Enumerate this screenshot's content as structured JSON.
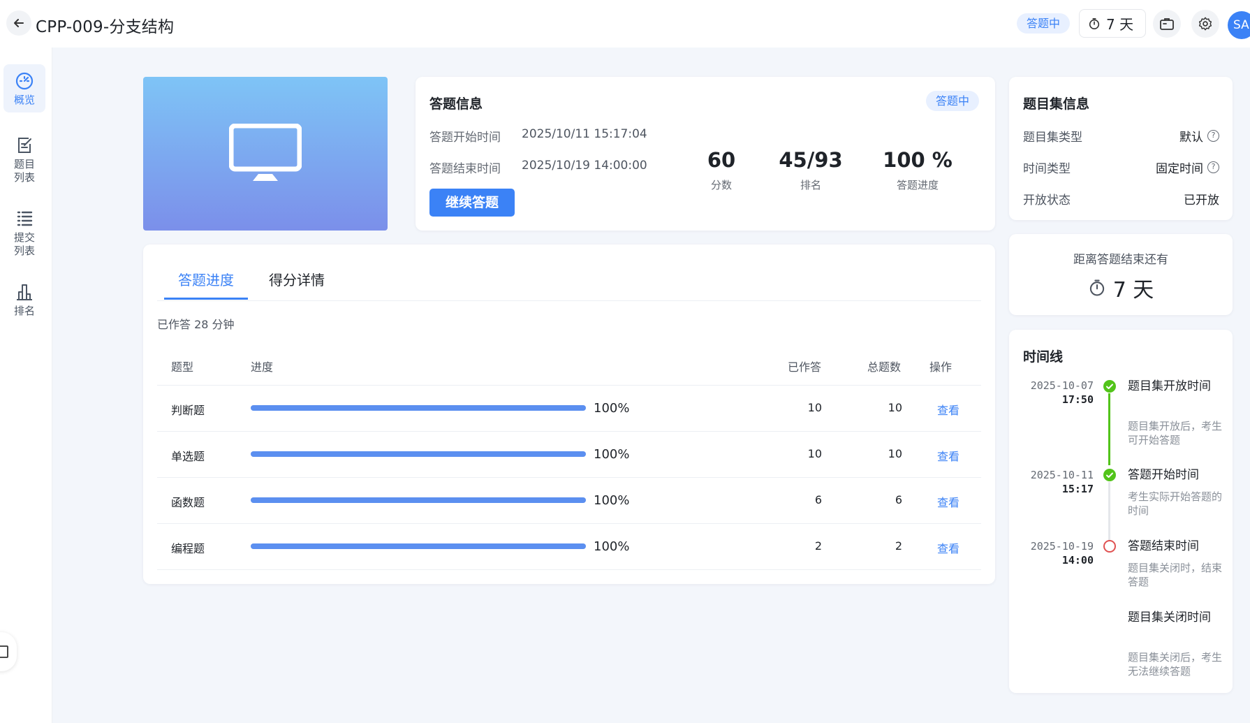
{
  "header": {
    "title": "CPP-009-分支结构",
    "status": "答题中",
    "timer": "7 天",
    "avatar": "SA"
  },
  "sidebar": {
    "items": [
      {
        "label": "概览",
        "icon": "dashboard-icon",
        "active": true
      },
      {
        "label": "题目\n列表",
        "icon": "edit-list-icon",
        "active": false
      },
      {
        "label": "提交\n列表",
        "icon": "list-icon",
        "active": false
      },
      {
        "label": "排名",
        "icon": "bar-chart-icon",
        "active": false
      }
    ]
  },
  "answer_info": {
    "title": "答题信息",
    "status": "答题中",
    "start_label": "答题开始时间",
    "start_value": "2025/10/11 15:17:04",
    "end_label": "答题结束时间",
    "end_value": "2025/10/19 14:00:00",
    "continue_button": "继续答题",
    "stats": [
      {
        "value": "60",
        "caption": "分数"
      },
      {
        "value": "45/93",
        "caption": "排名"
      },
      {
        "value": "100 %",
        "caption": "答题进度"
      }
    ]
  },
  "progress": {
    "tabs": [
      "答题进度",
      "得分详情"
    ],
    "elapsed": "已作答 28 分钟",
    "columns": [
      "题型",
      "进度",
      "已作答",
      "总题数",
      "操作"
    ],
    "rows": [
      {
        "type": "判断题",
        "progress": 100,
        "progress_text": "100%",
        "answered": "10",
        "total": "10",
        "action": "查看"
      },
      {
        "type": "单选题",
        "progress": 100,
        "progress_text": "100%",
        "answered": "10",
        "total": "10",
        "action": "查看"
      },
      {
        "type": "函数题",
        "progress": 100,
        "progress_text": "100%",
        "answered": "6",
        "total": "6",
        "action": "查看"
      },
      {
        "type": "编程题",
        "progress": 100,
        "progress_text": "100%",
        "answered": "2",
        "total": "2",
        "action": "查看"
      }
    ]
  },
  "set_info": {
    "title": "题目集信息",
    "rows": [
      {
        "label": "题目集类型",
        "value": "默认",
        "help": true
      },
      {
        "label": "时间类型",
        "value": "固定时间",
        "help": true
      },
      {
        "label": "开放状态",
        "value": "已开放",
        "help": false
      }
    ]
  },
  "countdown": {
    "label": "距离答题结束还有",
    "value": "7 天"
  },
  "timeline": {
    "title": "时间线",
    "items": [
      {
        "date": "2025-10-07",
        "time": "17:50",
        "title": "题目集开放时间",
        "desc": "题目集开放后，考生可开始答题",
        "status": "done"
      },
      {
        "date": "2025-10-11",
        "time": "15:17",
        "title": "答题开始时间",
        "desc": "考生实际开始答题的时间",
        "status": "done"
      },
      {
        "date": "2025-10-19",
        "time": "14:00",
        "title": "答题结束时间",
        "desc": "题目集关闭时，结束答题",
        "status": "pending"
      },
      {
        "date": "",
        "time": "",
        "title": "题目集关闭时间",
        "desc": "题目集关闭后，考生无法继续答题",
        "status": "none"
      }
    ]
  },
  "colors": {
    "accent": "#3b82f6",
    "success": "#52c41a",
    "danger": "#e05252"
  }
}
